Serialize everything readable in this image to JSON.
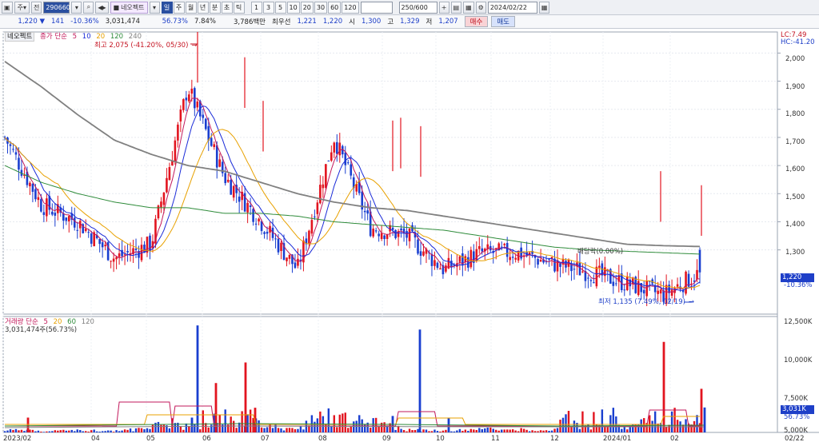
{
  "toolbar": {
    "type_label": "주",
    "jeon_label": "전",
    "code": "290660",
    "stock_name": "네오펙트",
    "period_tabs": [
      "일",
      "주",
      "월",
      "년",
      "분",
      "초",
      "틱"
    ],
    "active_period": "일",
    "minute_presets": [
      "1",
      "3",
      "5",
      "10",
      "20",
      "30",
      "60",
      "120"
    ],
    "count_label": "250",
    "count_total": "/600",
    "date": "2024/02/22"
  },
  "quote": {
    "price": "1,220",
    "change": "141",
    "change_pct": "-10.36%",
    "volume": "3,031,474",
    "volume_pct": "56.73%",
    "turnover": "7.84%",
    "amount": "3,786백만",
    "best_label": "최우선",
    "best_ask": "1,221",
    "best_bid": "1,220",
    "open_label": "시",
    "open": "1,300",
    "high_label": "고",
    "high": "1,329",
    "low_label": "저",
    "low": "1,207",
    "buy_label": "매수",
    "sell_label": "매도"
  },
  "chart_legend": {
    "name": "네오펙트",
    "main_label": "종가 단순",
    "ma_periods": [
      "5",
      "10",
      "20",
      "120",
      "240"
    ],
    "ma_colors": [
      "#c2185b",
      "#1a2bd8",
      "#e8a100",
      "#2e8b3a",
      "#808080"
    ],
    "high_note": "최고 2,075 (-41.20%, 05/30)",
    "low_note": "최저 1,135 (7.49%, 02/19)",
    "dividend_note": "배당락(0.00%)",
    "lc": "LC:7.49",
    "hc": "HC:-41.20"
  },
  "volume_legend": {
    "title": "거래량 단순",
    "ma_periods": [
      "5",
      "20",
      "60",
      "120"
    ],
    "ma_colors": [
      "#c2185b",
      "#e8a100",
      "#2e8b3a",
      "#808080"
    ],
    "today": "3,031,474주(56.73%)"
  },
  "price_axis": {
    "ticks": [
      "2,000",
      "1,900",
      "1,800",
      "1,700",
      "1,600",
      "1,500",
      "1,400",
      "1,300"
    ],
    "current": "1,220",
    "current_pct": "-10.36%"
  },
  "volume_axis": {
    "ticks": [
      "12,500K",
      "10,000K",
      "7,500K",
      "5,000K"
    ],
    "current": "3,031K",
    "current_pct": "56.73%"
  },
  "x_axis": {
    "labels": [
      "2023/02",
      "04",
      "05",
      "06",
      "07",
      "08",
      "09",
      "10",
      "11",
      "12",
      "2024/01",
      "02"
    ],
    "right_label": "02/22"
  },
  "chart_data": {
    "type": "candlestick",
    "ylim": [
      1100,
      2075
    ],
    "high": 2075,
    "low": 1135,
    "last_close": 1220,
    "last_open": 1300,
    "last_high": 1329,
    "last_low": 1207,
    "x": [
      "2023/02",
      "04",
      "05",
      "06",
      "07",
      "08",
      "09",
      "10",
      "11",
      "12",
      "2024/01",
      "02",
      "02/22"
    ],
    "close": [
      1700,
      1460,
      1400,
      1270,
      1320,
      1880,
      1560,
      1400,
      1230,
      1700,
      1380,
      1350,
      1230,
      1290,
      1290,
      1250,
      1220,
      1180,
      1140,
      1220
    ],
    "ma240": [
      1970,
      1880,
      1780,
      1690,
      1640,
      1600,
      1580,
      1540,
      1500,
      1470,
      1450,
      1440,
      1420,
      1400,
      1380,
      1360,
      1340,
      1320,
      1315,
      1312
    ],
    "ma120": [
      1600,
      1540,
      1500,
      1470,
      1450,
      1450,
      1430,
      1430,
      1420,
      1400,
      1390,
      1380,
      1370,
      1350,
      1330,
      1310,
      1300,
      1295,
      1290,
      1285
    ],
    "volume_series": {
      "name": "volume",
      "ylim": [
        0,
        13500
      ],
      "unit": "K",
      "values": [
        700,
        300,
        500,
        400,
        900,
        13000,
        8000,
        2000,
        500,
        6000,
        2500,
        600,
        400,
        800,
        700,
        500,
        11000,
        700,
        5300,
        3031
      ]
    }
  }
}
